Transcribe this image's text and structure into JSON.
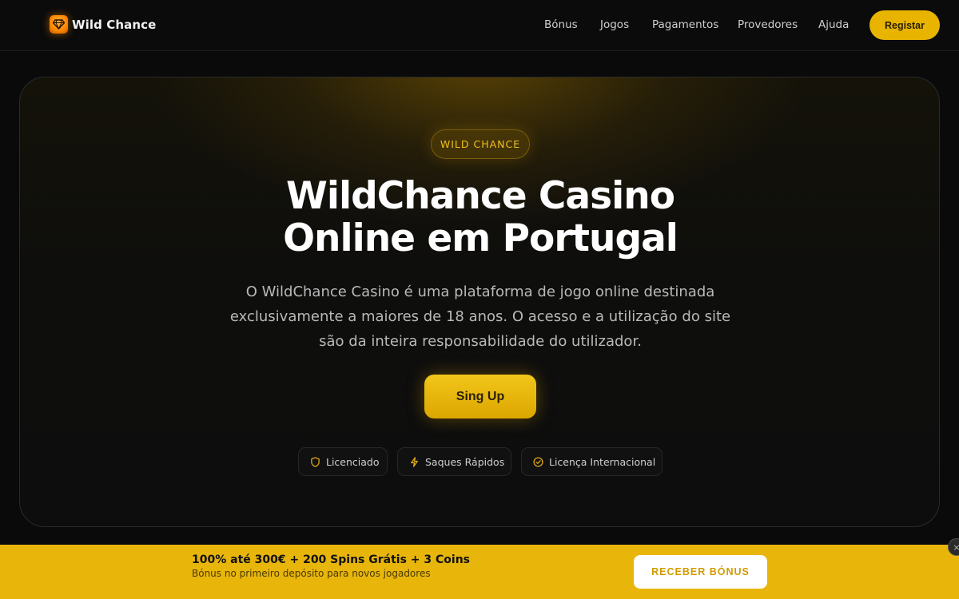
{
  "header": {
    "brand": "Wild Chance",
    "nav": [
      "Bónus",
      "Jogos",
      "Pagamentos",
      "Provedores",
      "Ajuda"
    ],
    "register_label": "Registar"
  },
  "hero": {
    "pill": "WILD CHANCE",
    "title_line1": "WildChance Casino",
    "title_line2": "Online em Portugal",
    "description": "O WildChance Casino é uma plataforma de jogo online destinada exclusivamente a maiores de 18 anos. O acesso e a utilização do site são da inteira responsabilidade do utilizador.",
    "cta_label": "Sing Up",
    "badges": [
      {
        "label": "Licenciado",
        "icon": "shield-icon"
      },
      {
        "label": "Saques Rápidos",
        "icon": "lightning-icon"
      },
      {
        "label": "Licença Internacional",
        "icon": "check-circle-icon"
      }
    ]
  },
  "bonus_bar": {
    "title": "100% até 300€ + 200 Spins Grátis + 3 Coins",
    "subtitle": "Bónus no primeiro depósito para novos jogadores",
    "button_label": "RECEBER BÓNUS",
    "close_glyph": "×"
  },
  "colors": {
    "accent": "#e8b400",
    "background": "#0a0a0a",
    "bonus_bar": "#e8b50b"
  }
}
